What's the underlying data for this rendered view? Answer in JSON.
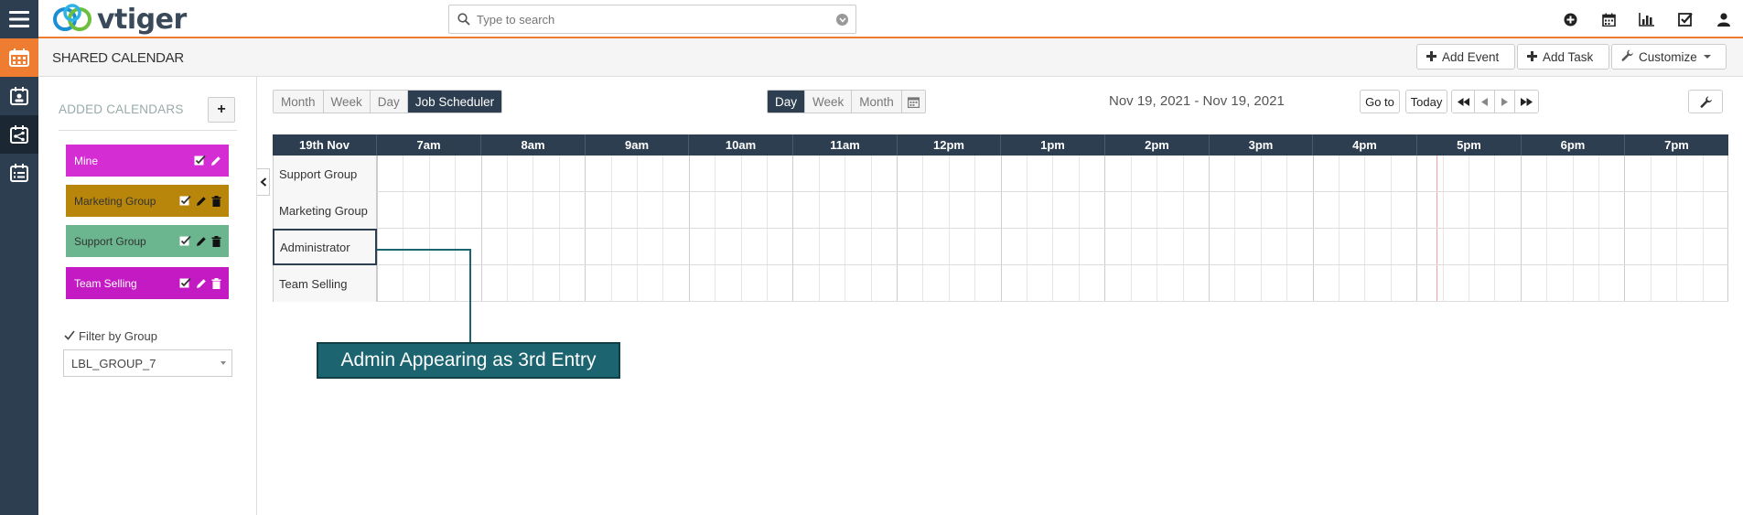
{
  "app": {
    "logo_text": "vtiger"
  },
  "search": {
    "placeholder": "Type to search"
  },
  "top_icons": [
    "plus-circle-icon",
    "calendar-icon",
    "bar-chart-icon",
    "checkbox-icon",
    "user-icon"
  ],
  "rail": {
    "items": [
      "calendar-icon",
      "contact-calendar-icon",
      "shared-calendar-icon",
      "list-calendar-icon"
    ]
  },
  "header": {
    "title": "SHARED CALENDAR",
    "add_event": "Add Event",
    "add_task": "Add Task",
    "customize": "Customize"
  },
  "sidebar": {
    "added_title": "ADDED CALENDARS",
    "add_button": "+",
    "calendars": [
      {
        "name": "Mine",
        "color": "#d52dd4"
      },
      {
        "name": "Marketing Group",
        "color": "#b8860b"
      },
      {
        "name": "Support Group",
        "color": "#6bb58f"
      },
      {
        "name": "Team Selling",
        "color": "#c41ac4"
      }
    ],
    "filter_label": "Filter by Group",
    "group_select": "LBL_GROUP_7"
  },
  "view_tabs": {
    "items": [
      "Month",
      "Week",
      "Day",
      "Job Scheduler"
    ],
    "active": "Job Scheduler"
  },
  "range_tabs": {
    "items": [
      "Day",
      "Week",
      "Month"
    ],
    "active": "Day"
  },
  "date_range": "Nov 19, 2021 - Nov 19, 2021",
  "nav": {
    "goto": "Go to",
    "today": "Today"
  },
  "scheduler": {
    "corner_label": "19th Nov",
    "hours": [
      "7am",
      "8am",
      "9am",
      "10am",
      "11am",
      "12pm",
      "1pm",
      "2pm",
      "3pm",
      "4pm",
      "5pm",
      "6pm",
      "7pm"
    ],
    "rows": [
      "Support Group",
      "Marketing Group",
      "Administrator",
      "Team Selling"
    ]
  },
  "annotation": {
    "text": "Admin Appearing as 3rd Entry"
  },
  "colors": {
    "rail": "#2c3e50",
    "accent": "#ef7d31",
    "callout": "#1b6470"
  }
}
